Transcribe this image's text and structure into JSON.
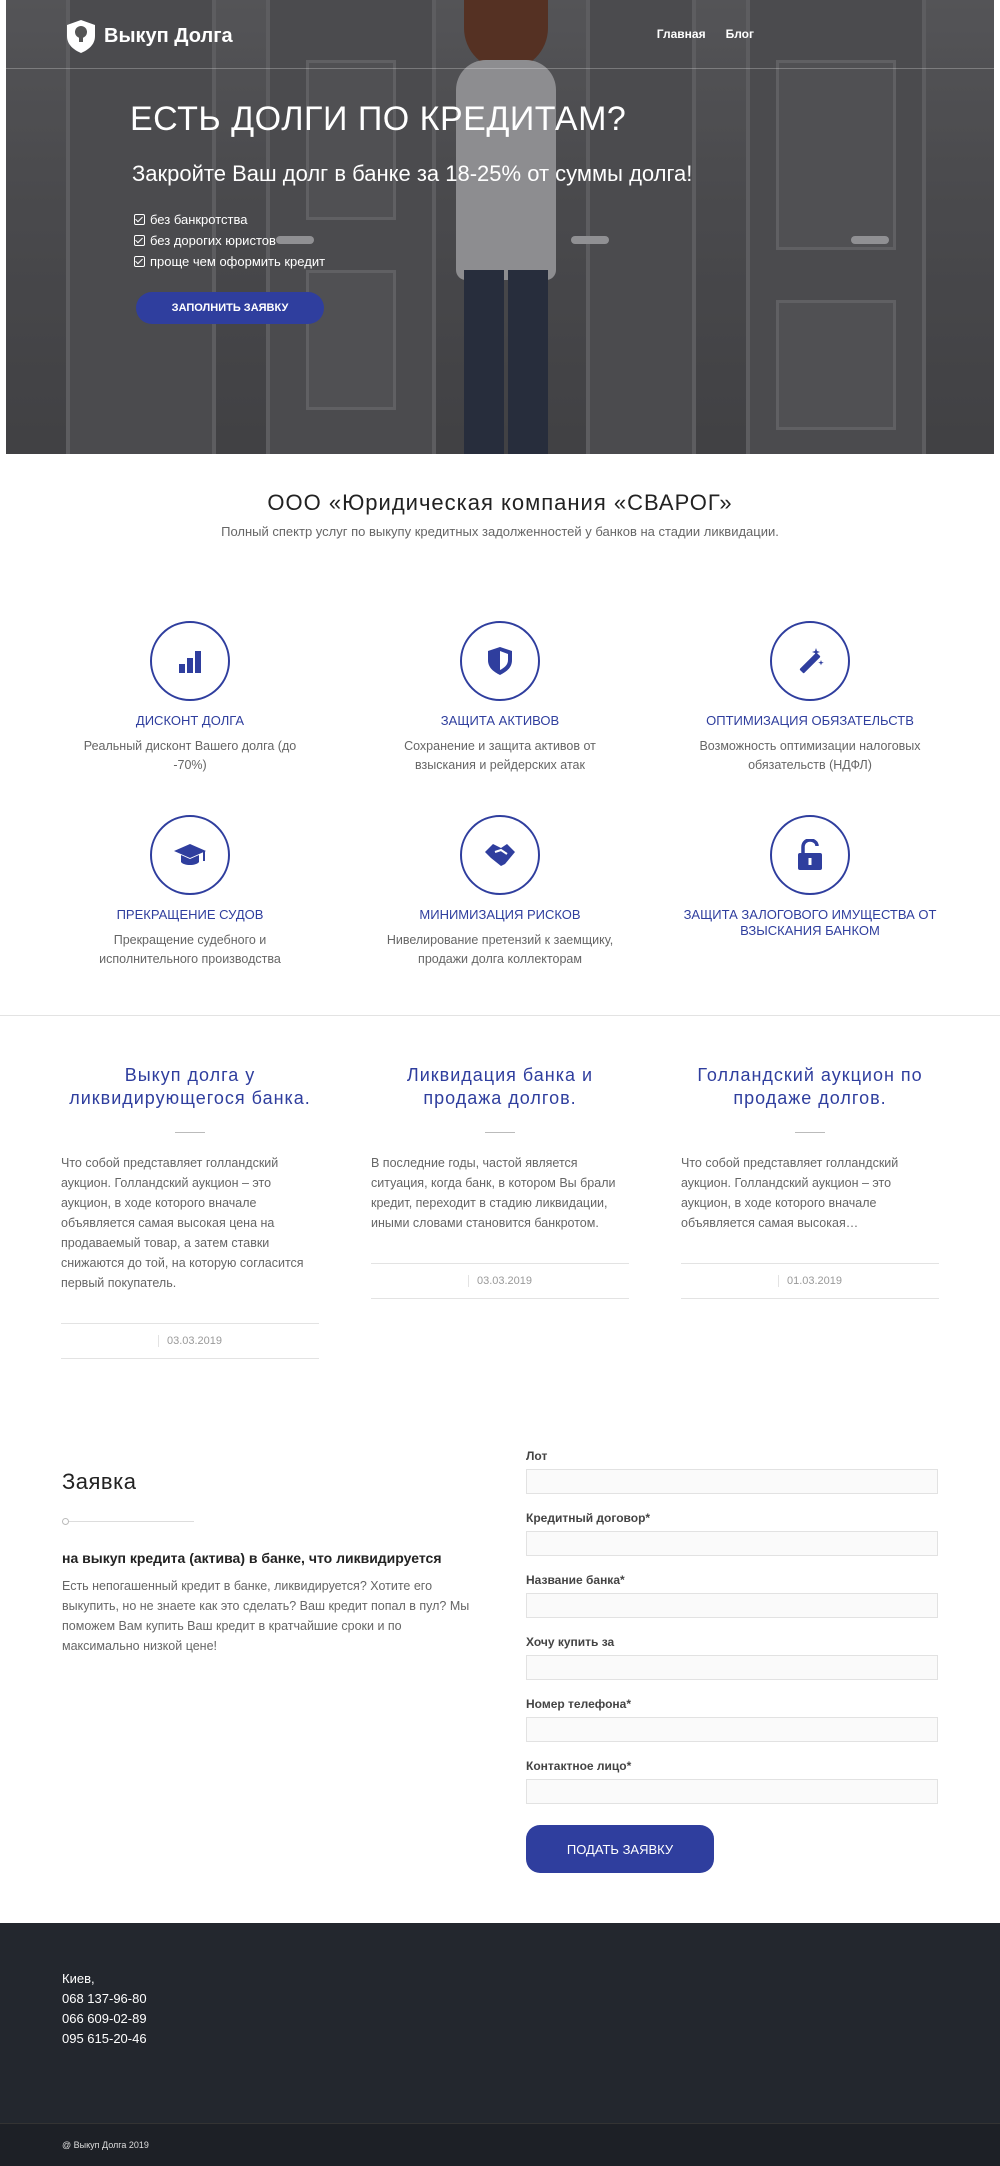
{
  "header": {
    "logo_text": "Выкуп Долга",
    "nav": [
      "Главная",
      "Блог"
    ]
  },
  "hero": {
    "title": "ЕСТЬ ДОЛГИ ПО КРЕДИТАМ?",
    "subtitle": "Закройте Ваш долг в банке за 18-25% от суммы долга!",
    "checks": [
      "без банкротства",
      "без дорогих юристов",
      "проще чем оформить кредит"
    ],
    "button": "ЗАПОЛНИТЬ ЗАЯВКУ"
  },
  "company": {
    "title": "ООО «Юридическая компания «СВАРОГ»",
    "subtitle": "Полный спектр услуг по выкупу кредитных задолженностей у банков на стадии ликвидации."
  },
  "features": [
    {
      "icon": "bar-chart-icon",
      "title": "ДИСКОНТ ДОЛГА",
      "text": "Реальный дисконт Вашего долга (до -70%)"
    },
    {
      "icon": "shield-icon",
      "title": "ЗАЩИТА АКТИВОВ",
      "text": "Сохранение и защита активов от взыскания и рейдерских атак"
    },
    {
      "icon": "magic-wand-icon",
      "title": "ОПТИМИЗАЦИЯ ОБЯЗАТЕЛЬСТВ",
      "text": "Возможность оптимизации налоговых обязательств (НДФЛ)"
    },
    {
      "icon": "graduation-cap-icon",
      "title": "ПРЕКРАЩЕНИЕ СУДОВ",
      "text": "Прекращение судебного и исполнительного производства"
    },
    {
      "icon": "handshake-icon",
      "title": "МИНИМИЗАЦИЯ РИСКОВ",
      "text": "Нивелирование претензий к заемщику, продажи долга коллекторам"
    },
    {
      "icon": "unlock-icon",
      "title": "ЗАЩИТА ЗАЛОГОВОГО ИМУЩЕСТВА ОТ ВЗЫСКАНИЯ БАНКОМ",
      "text": ""
    }
  ],
  "posts": [
    {
      "title": "Выкуп долга у ликвидирующегося банка.",
      "excerpt": "Что собой представляет голландский аукцион. Голландский аукцион – это аукцион, в ходе которого вначале объявляется самая высокая цена на продаваемый товар, а затем ставки снижаются до той, на которую согласится первый покупатель.",
      "date": "03.03.2019"
    },
    {
      "title": "Ликвидация банка и продажа долгов.",
      "excerpt": "В последние годы, частой является ситуация, когда банк, в котором Вы брали кредит, переходит в стадию ликвидации, иными словами становится банкротом.",
      "date": "03.03.2019"
    },
    {
      "title": "Голландский аукцион по продаже долгов.",
      "excerpt": "Что собой представляет голландский аукцион. Голландский аукцион – это аукцион, в ходе которого вначале объявляется самая высокая…",
      "date": "01.03.2019"
    }
  ],
  "request": {
    "title": "Заявка",
    "subtitle": "на выкуп кредита (актива) в банке, что ликвидируется",
    "text": "Есть непогашенный кредит в банке, ликвидируется? Хотите его выкупить, но не знаете как это сделать? Ваш кредит попал в пул? Мы поможем Вам купить Ваш кредит в кратчайшие сроки и по максимально низкой цене!",
    "fields": [
      "Лот",
      "Кредитный договор*",
      "Название банка*",
      "Хочу купить за",
      "Номер телефона*",
      "Контактное лицо*"
    ],
    "submit": "ПОДАТЬ ЗАЯВКУ"
  },
  "footer": {
    "city": "Киев,",
    "phones": [
      "068 137-96-80",
      "066 609-02-89",
      "095 615-20-46"
    ],
    "copyright": "@ Выкуп Долга 2019"
  },
  "colors": {
    "accent": "#2f3e9e",
    "footer_bg": "#23272e"
  }
}
